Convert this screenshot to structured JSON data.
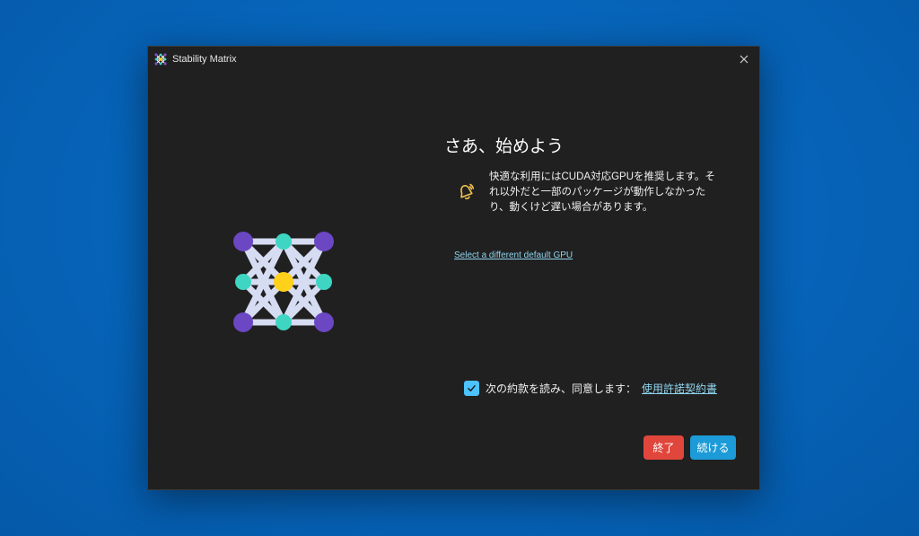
{
  "window": {
    "title": "Stability Matrix",
    "app_icon": "stability-matrix-logo"
  },
  "main": {
    "heading": "さあ、始めよう",
    "warning_icon": "bell-icon",
    "warning_text": "快適な利用にはCUDA対応GPUを推奨します。それ以外だと一部のパッケージが動作しなかったり、動くけど遅い場合があります。",
    "gpu_link": "Select a different default GPU"
  },
  "agreement": {
    "checked": true,
    "text": "次の約款を読み、同意します：",
    "link": "使用許諾契約書"
  },
  "buttons": {
    "quit": "終了",
    "continue": "続ける"
  },
  "colors": {
    "background": "#0663b8",
    "window": "#202020",
    "accent": "#4cc2ff",
    "quit_button": "#e0463c",
    "continue_button": "#1c9bd8",
    "link": "#8fd3ec"
  }
}
